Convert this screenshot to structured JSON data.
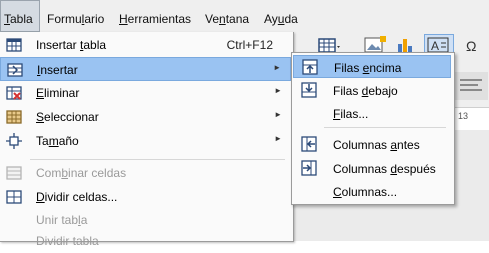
{
  "menubar": {
    "items": [
      {
        "pre": "",
        "u": "T",
        "post": "abla"
      },
      {
        "pre": "Formu",
        "u": "l",
        "post": "ario"
      },
      {
        "pre": "",
        "u": "H",
        "post": "erramientas"
      },
      {
        "pre": "Ve",
        "u": "n",
        "post": "tana"
      },
      {
        "pre": "Ay",
        "u": "u",
        "post": "da"
      }
    ]
  },
  "ruler": {
    "number": "13"
  },
  "tabla_menu": {
    "items": [
      {
        "pre": "Insertar ",
        "u": "t",
        "post": "abla",
        "shortcut": "Ctrl+F12"
      },
      {
        "pre": "",
        "u": "I",
        "post": "nsertar"
      },
      {
        "pre": "",
        "u": "E",
        "post": "liminar"
      },
      {
        "pre": "",
        "u": "S",
        "post": "eleccionar"
      },
      {
        "pre": "Ta",
        "u": "m",
        "post": "año"
      },
      {
        "pre": "Com",
        "u": "b",
        "post": "inar celdas"
      },
      {
        "pre": "",
        "u": "D",
        "post": "ividir celdas..."
      },
      {
        "pre": "Unir tab",
        "u": "l",
        "post": "a"
      },
      {
        "pre": "Dividir tabla",
        "u": "",
        "post": ""
      }
    ]
  },
  "insertar_submenu": {
    "items": [
      {
        "pre": "Filas ",
        "u": "e",
        "post": "ncima"
      },
      {
        "pre": "Filas ",
        "u": "d",
        "post": "ebajo"
      },
      {
        "pre": "",
        "u": "F",
        "post": "ilas..."
      },
      {
        "pre": "Columnas ",
        "u": "a",
        "post": "ntes"
      },
      {
        "pre": "Columnas ",
        "u": "d",
        "post": "espués"
      },
      {
        "pre": "",
        "u": "C",
        "post": "olumnas..."
      }
    ]
  }
}
